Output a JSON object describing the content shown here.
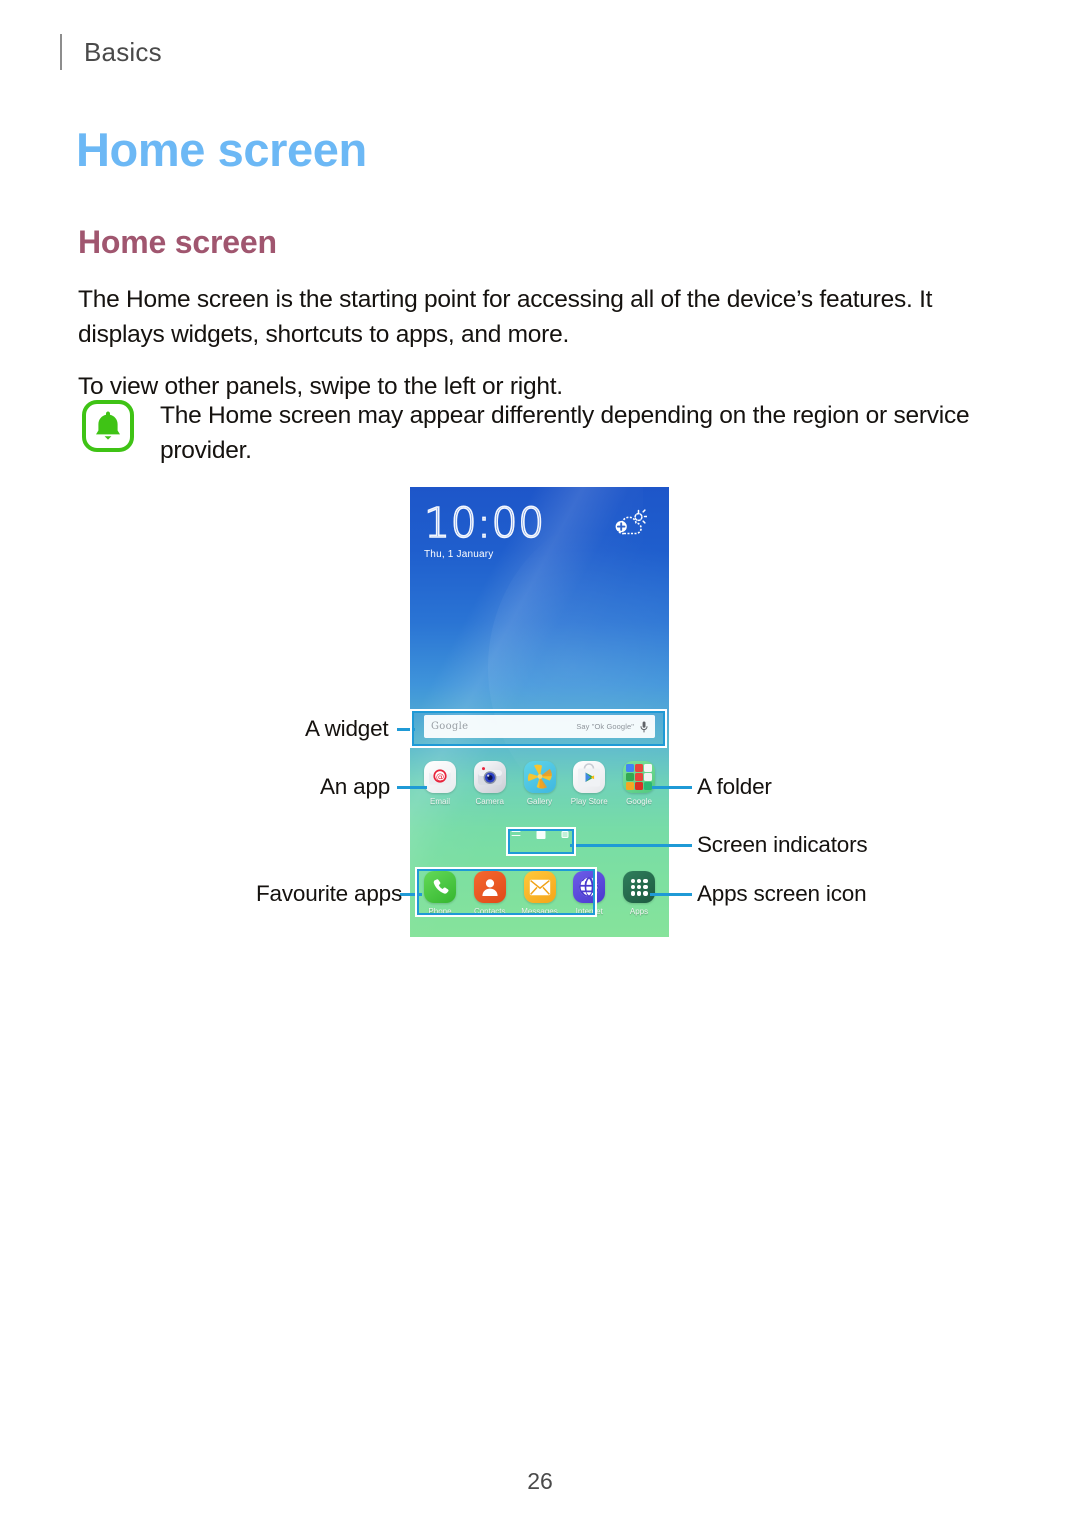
{
  "header": {
    "breadcrumb": "Basics"
  },
  "chapter_title": "Home screen",
  "section_title": "Home screen",
  "paragraphs": [
    "The Home screen is the starting point for accessing all of the device’s features. It displays widgets, shortcuts to apps, and more.",
    "To view other panels, swipe to the left or right."
  ],
  "note": {
    "icon": "bell-icon",
    "text": "The Home screen may appear differently depending on the region or service provider."
  },
  "figure": {
    "phone": {
      "clock": {
        "time": "10:00",
        "date": "Thu, 1 January"
      },
      "weather_icon": "weather-add-icon",
      "search_widget": {
        "placeholder": "Google",
        "hint": "Say \"Ok Google\"",
        "mic_icon": "microphone-icon"
      },
      "app_row": [
        {
          "label": "Email",
          "icon": "email-icon"
        },
        {
          "label": "Camera",
          "icon": "camera-icon"
        },
        {
          "label": "Gallery",
          "icon": "gallery-icon"
        },
        {
          "label": "Play Store",
          "icon": "play-store-icon"
        },
        {
          "label": "Google",
          "icon": "google-folder-icon"
        }
      ],
      "dock_row": [
        {
          "label": "Phone",
          "icon": "phone-icon"
        },
        {
          "label": "Contacts",
          "icon": "contacts-icon"
        },
        {
          "label": "Messages",
          "icon": "messages-icon"
        },
        {
          "label": "Internet",
          "icon": "internet-icon"
        },
        {
          "label": "Apps",
          "icon": "apps-grid-icon"
        }
      ],
      "indicators": {
        "lines_icon": "list-indicator-icon",
        "home_icon": "home-indicator-icon",
        "square_icon": "square-indicator-icon"
      }
    },
    "callouts_left": [
      "A widget",
      "An app",
      "Favourite apps"
    ],
    "callouts_right": [
      "A folder",
      "Screen indicators",
      "Apps screen icon"
    ]
  },
  "page_number": "26",
  "colors": {
    "chapter_title": "#6cb8f5",
    "section_title": "#a0566f",
    "note_icon": "#3fc315",
    "callout_line": "#1f9ad6",
    "highlight": "#1f9ad6"
  }
}
